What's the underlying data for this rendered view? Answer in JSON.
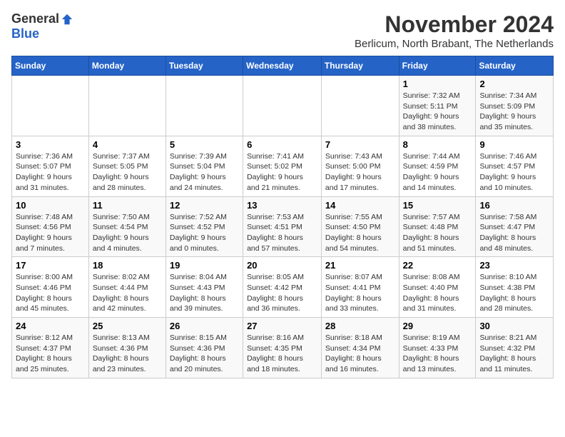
{
  "logo": {
    "general": "General",
    "blue": "Blue"
  },
  "header": {
    "month_year": "November 2024",
    "location": "Berlicum, North Brabant, The Netherlands"
  },
  "days_of_week": [
    "Sunday",
    "Monday",
    "Tuesday",
    "Wednesday",
    "Thursday",
    "Friday",
    "Saturday"
  ],
  "weeks": [
    [
      {
        "day": "",
        "info": ""
      },
      {
        "day": "",
        "info": ""
      },
      {
        "day": "",
        "info": ""
      },
      {
        "day": "",
        "info": ""
      },
      {
        "day": "",
        "info": ""
      },
      {
        "day": "1",
        "info": "Sunrise: 7:32 AM\nSunset: 5:11 PM\nDaylight: 9 hours and 38 minutes."
      },
      {
        "day": "2",
        "info": "Sunrise: 7:34 AM\nSunset: 5:09 PM\nDaylight: 9 hours and 35 minutes."
      }
    ],
    [
      {
        "day": "3",
        "info": "Sunrise: 7:36 AM\nSunset: 5:07 PM\nDaylight: 9 hours and 31 minutes."
      },
      {
        "day": "4",
        "info": "Sunrise: 7:37 AM\nSunset: 5:05 PM\nDaylight: 9 hours and 28 minutes."
      },
      {
        "day": "5",
        "info": "Sunrise: 7:39 AM\nSunset: 5:04 PM\nDaylight: 9 hours and 24 minutes."
      },
      {
        "day": "6",
        "info": "Sunrise: 7:41 AM\nSunset: 5:02 PM\nDaylight: 9 hours and 21 minutes."
      },
      {
        "day": "7",
        "info": "Sunrise: 7:43 AM\nSunset: 5:00 PM\nDaylight: 9 hours and 17 minutes."
      },
      {
        "day": "8",
        "info": "Sunrise: 7:44 AM\nSunset: 4:59 PM\nDaylight: 9 hours and 14 minutes."
      },
      {
        "day": "9",
        "info": "Sunrise: 7:46 AM\nSunset: 4:57 PM\nDaylight: 9 hours and 10 minutes."
      }
    ],
    [
      {
        "day": "10",
        "info": "Sunrise: 7:48 AM\nSunset: 4:56 PM\nDaylight: 9 hours and 7 minutes."
      },
      {
        "day": "11",
        "info": "Sunrise: 7:50 AM\nSunset: 4:54 PM\nDaylight: 9 hours and 4 minutes."
      },
      {
        "day": "12",
        "info": "Sunrise: 7:52 AM\nSunset: 4:52 PM\nDaylight: 9 hours and 0 minutes."
      },
      {
        "day": "13",
        "info": "Sunrise: 7:53 AM\nSunset: 4:51 PM\nDaylight: 8 hours and 57 minutes."
      },
      {
        "day": "14",
        "info": "Sunrise: 7:55 AM\nSunset: 4:50 PM\nDaylight: 8 hours and 54 minutes."
      },
      {
        "day": "15",
        "info": "Sunrise: 7:57 AM\nSunset: 4:48 PM\nDaylight: 8 hours and 51 minutes."
      },
      {
        "day": "16",
        "info": "Sunrise: 7:58 AM\nSunset: 4:47 PM\nDaylight: 8 hours and 48 minutes."
      }
    ],
    [
      {
        "day": "17",
        "info": "Sunrise: 8:00 AM\nSunset: 4:46 PM\nDaylight: 8 hours and 45 minutes."
      },
      {
        "day": "18",
        "info": "Sunrise: 8:02 AM\nSunset: 4:44 PM\nDaylight: 8 hours and 42 minutes."
      },
      {
        "day": "19",
        "info": "Sunrise: 8:04 AM\nSunset: 4:43 PM\nDaylight: 8 hours and 39 minutes."
      },
      {
        "day": "20",
        "info": "Sunrise: 8:05 AM\nSunset: 4:42 PM\nDaylight: 8 hours and 36 minutes."
      },
      {
        "day": "21",
        "info": "Sunrise: 8:07 AM\nSunset: 4:41 PM\nDaylight: 8 hours and 33 minutes."
      },
      {
        "day": "22",
        "info": "Sunrise: 8:08 AM\nSunset: 4:40 PM\nDaylight: 8 hours and 31 minutes."
      },
      {
        "day": "23",
        "info": "Sunrise: 8:10 AM\nSunset: 4:38 PM\nDaylight: 8 hours and 28 minutes."
      }
    ],
    [
      {
        "day": "24",
        "info": "Sunrise: 8:12 AM\nSunset: 4:37 PM\nDaylight: 8 hours and 25 minutes."
      },
      {
        "day": "25",
        "info": "Sunrise: 8:13 AM\nSunset: 4:36 PM\nDaylight: 8 hours and 23 minutes."
      },
      {
        "day": "26",
        "info": "Sunrise: 8:15 AM\nSunset: 4:36 PM\nDaylight: 8 hours and 20 minutes."
      },
      {
        "day": "27",
        "info": "Sunrise: 8:16 AM\nSunset: 4:35 PM\nDaylight: 8 hours and 18 minutes."
      },
      {
        "day": "28",
        "info": "Sunrise: 8:18 AM\nSunset: 4:34 PM\nDaylight: 8 hours and 16 minutes."
      },
      {
        "day": "29",
        "info": "Sunrise: 8:19 AM\nSunset: 4:33 PM\nDaylight: 8 hours and 13 minutes."
      },
      {
        "day": "30",
        "info": "Sunrise: 8:21 AM\nSunset: 4:32 PM\nDaylight: 8 hours and 11 minutes."
      }
    ]
  ]
}
